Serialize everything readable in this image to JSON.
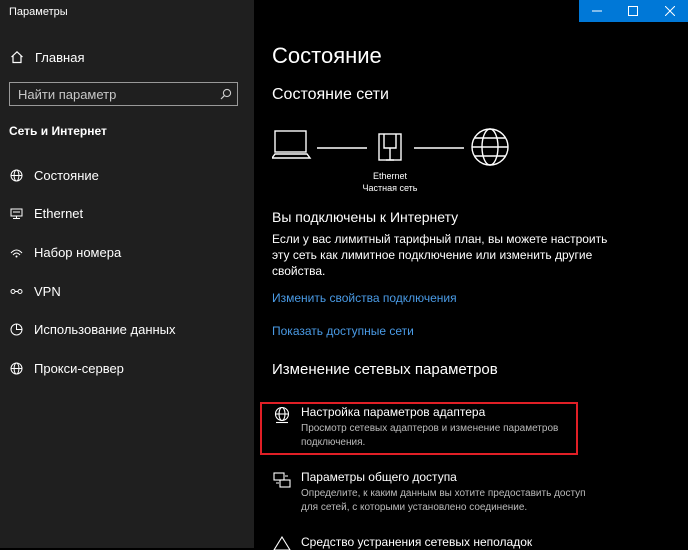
{
  "window": {
    "title": "Параметры"
  },
  "sidebar": {
    "home_label": "Главная",
    "search_placeholder": "Найти параметр",
    "section_title": "Сеть и Интернет",
    "items": [
      {
        "label": "Состояние",
        "icon": "globe-icon"
      },
      {
        "label": "Ethernet",
        "icon": "ethernet-icon"
      },
      {
        "label": "Набор номера",
        "icon": "dialup-icon"
      },
      {
        "label": "VPN",
        "icon": "vpn-icon"
      },
      {
        "label": "Использование данных",
        "icon": "data-usage-icon"
      },
      {
        "label": "Прокси-сервер",
        "icon": "globe-icon"
      }
    ]
  },
  "main": {
    "page_title": "Состояние",
    "network_status_title": "Состояние сети",
    "diagram": {
      "adapter": "Ethernet",
      "network": "Частная сеть"
    },
    "connected_title": "Вы подключены к Интернету",
    "connected_desc": "Если у вас лимитный тарифный план, вы можете настроить эту сеть как лимитное подключение или изменить другие свойства.",
    "link_change_props": "Изменить свойства подключения",
    "link_show_networks": "Показать доступные сети",
    "change_section_title": "Изменение сетевых параметров",
    "options": [
      {
        "title": "Настройка параметров адаптера",
        "desc": "Просмотр сетевых адаптеров и изменение параметров подключения."
      },
      {
        "title": "Параметры общего доступа",
        "desc": "Определите, к каким данным вы хотите предоставить доступ для сетей, с которыми установлено соединение."
      },
      {
        "title": "Средство устранения сетевых неполадок",
        "desc": ""
      }
    ]
  },
  "colors": {
    "accent": "#0078d7",
    "link": "#4a9be6",
    "highlight": "#e01f26"
  }
}
